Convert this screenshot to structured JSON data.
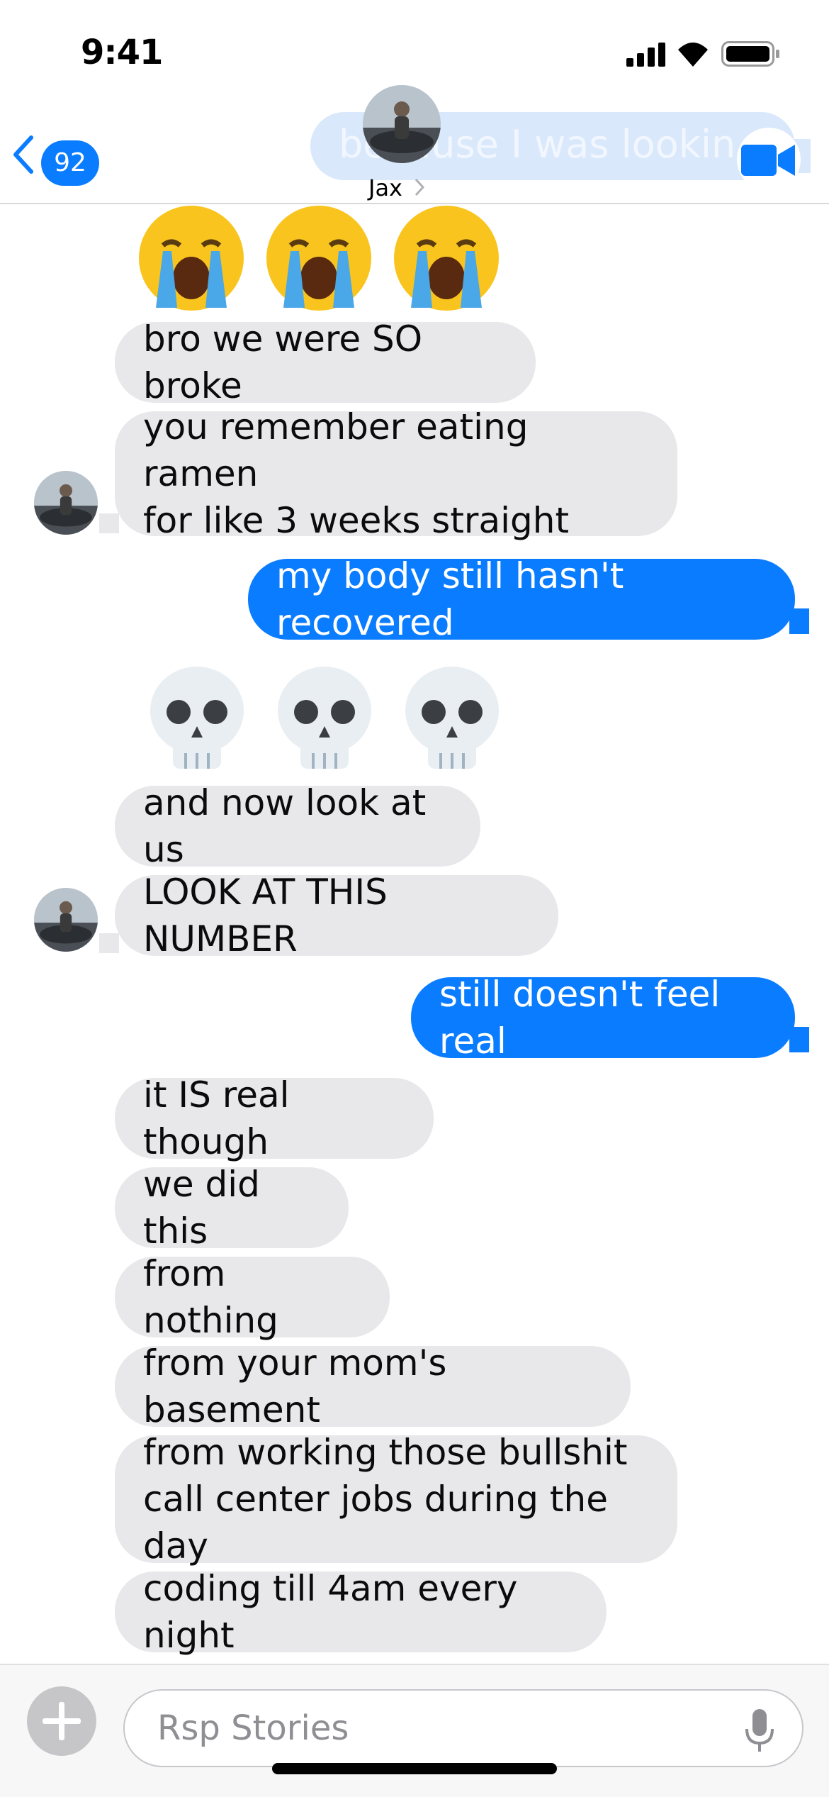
{
  "status_bar": {
    "time": "9:41"
  },
  "header": {
    "back_badge_count": "92",
    "contact_name": "Jax",
    "preview_text": "because I was looking to"
  },
  "messages": {
    "emoji_row_1": [
      "😭",
      "😭",
      "😭"
    ],
    "m1": "bro we were SO broke",
    "m2": "you remember eating ramen\nfor like 3 weeks straight",
    "m3": "my body still hasn't recovered",
    "emoji_row_2": [
      "💀",
      "💀",
      "💀"
    ],
    "m4": "and now look at us",
    "m5": "LOOK AT THIS NUMBER",
    "m6": "still doesn't feel real",
    "m7": "it IS real though",
    "m8": "we did this",
    "m9": "from nothing",
    "m10": "from your mom's basement",
    "m11": "from working those bullshit\ncall center jobs during the day",
    "m12": "coding till 4am every night"
  },
  "composer": {
    "placeholder": "Rsp Stories"
  },
  "colors": {
    "accent": "#0a7cff",
    "incoming_bubble": "#e8e8eb",
    "badge": "#0a7cff"
  },
  "icons": [
    "signal-icon",
    "wifi-icon",
    "battery-icon",
    "back-chevron-icon",
    "video-camera-icon",
    "plus-icon",
    "microphone-icon"
  ]
}
